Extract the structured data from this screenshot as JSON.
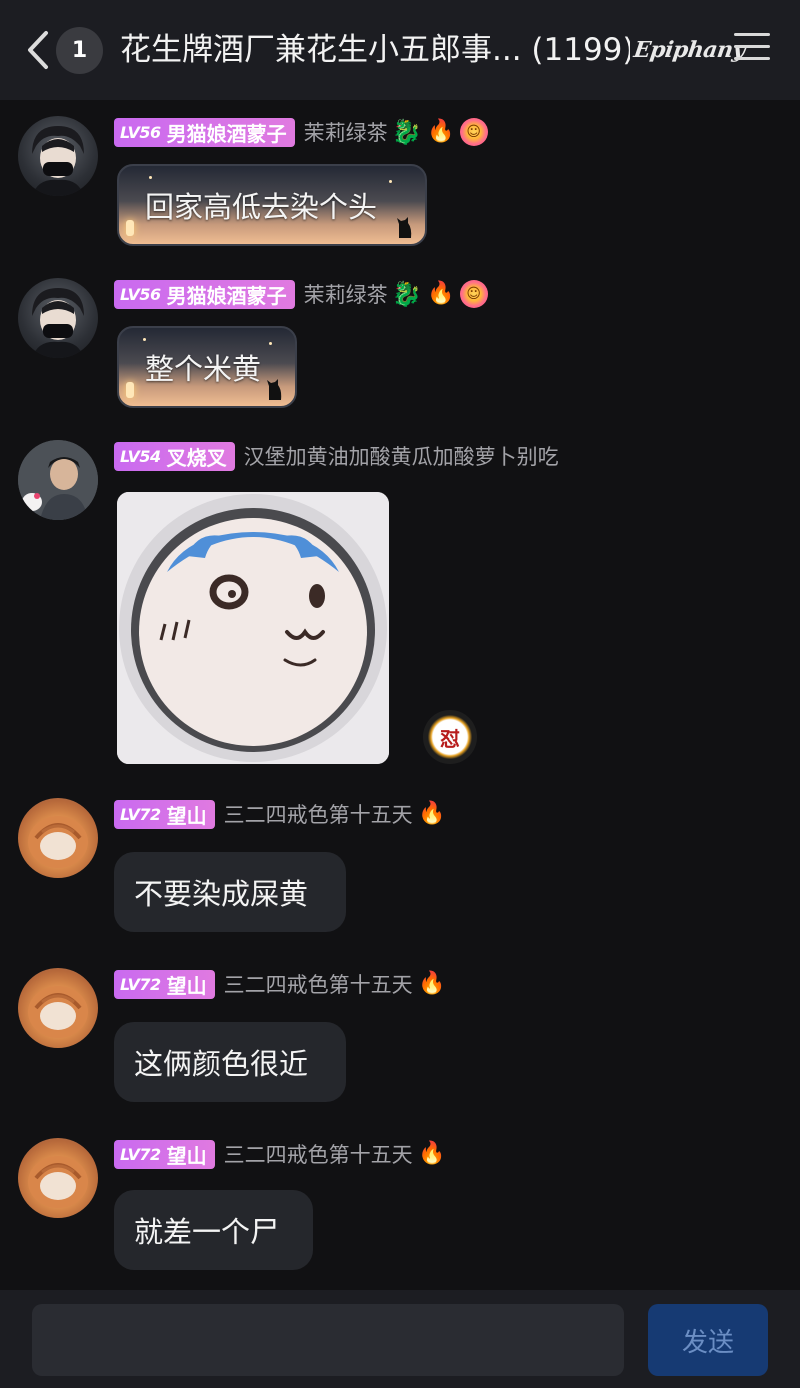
{
  "header": {
    "unread_count": "1",
    "title": "花生牌酒厂兼花生小五郎事... (1199)",
    "brand_logo": "Epiphany",
    "back_icon": "chevron-left-icon",
    "menu_icon": "hamburger-menu-icon"
  },
  "messages": [
    {
      "level": "LV56",
      "nickname": "男猫娘酒蒙子",
      "signature": "茉莉绿茶",
      "avatar": "anime-boy-mask-avatar",
      "emblems": [
        "dragon-emblem-icon",
        "flame-icon",
        "flower-smile-icon"
      ],
      "text": "回家高低去染个头",
      "style": "sunset-cat-bubble"
    },
    {
      "level": "LV56",
      "nickname": "男猫娘酒蒙子",
      "signature": "茉莉绿茶",
      "avatar": "anime-boy-mask-avatar",
      "emblems": [
        "dragon-emblem-icon",
        "flame-icon",
        "flower-smile-icon"
      ],
      "text": "整个米黄",
      "style": "sunset-cat-bubble"
    },
    {
      "level": "LV54",
      "nickname": "叉烧叉",
      "signature": "汉堡加黄油加酸黄瓜加酸萝卜别吃",
      "avatar": "young-man-photo-avatar",
      "sticker": "chiikawa-style-cake-sticker",
      "reaction": "怼"
    },
    {
      "level": "LV72",
      "nickname": "望山",
      "signature": "三二四戒色第十五天",
      "avatar": "sleeping-cat-avatar",
      "emblems": [
        "flame-icon"
      ],
      "text": "不要染成屎黄"
    },
    {
      "level": "LV72",
      "nickname": "望山",
      "signature": "三二四戒色第十五天",
      "avatar": "sleeping-cat-avatar",
      "emblems": [
        "flame-icon"
      ],
      "text": "这俩颜色很近"
    },
    {
      "level": "LV72",
      "nickname": "望山",
      "signature": "三二四戒色第十五天",
      "avatar": "sleeping-cat-avatar",
      "emblems": [
        "flame-icon"
      ],
      "text": "就差一个尸"
    }
  ],
  "composer": {
    "placeholder": "",
    "send_label": "发送"
  },
  "colors": {
    "background": "#111113",
    "header": "#1c1d22",
    "bubble": "#25272c",
    "level_badge": "#d070e8",
    "send_button": "#163a73"
  }
}
